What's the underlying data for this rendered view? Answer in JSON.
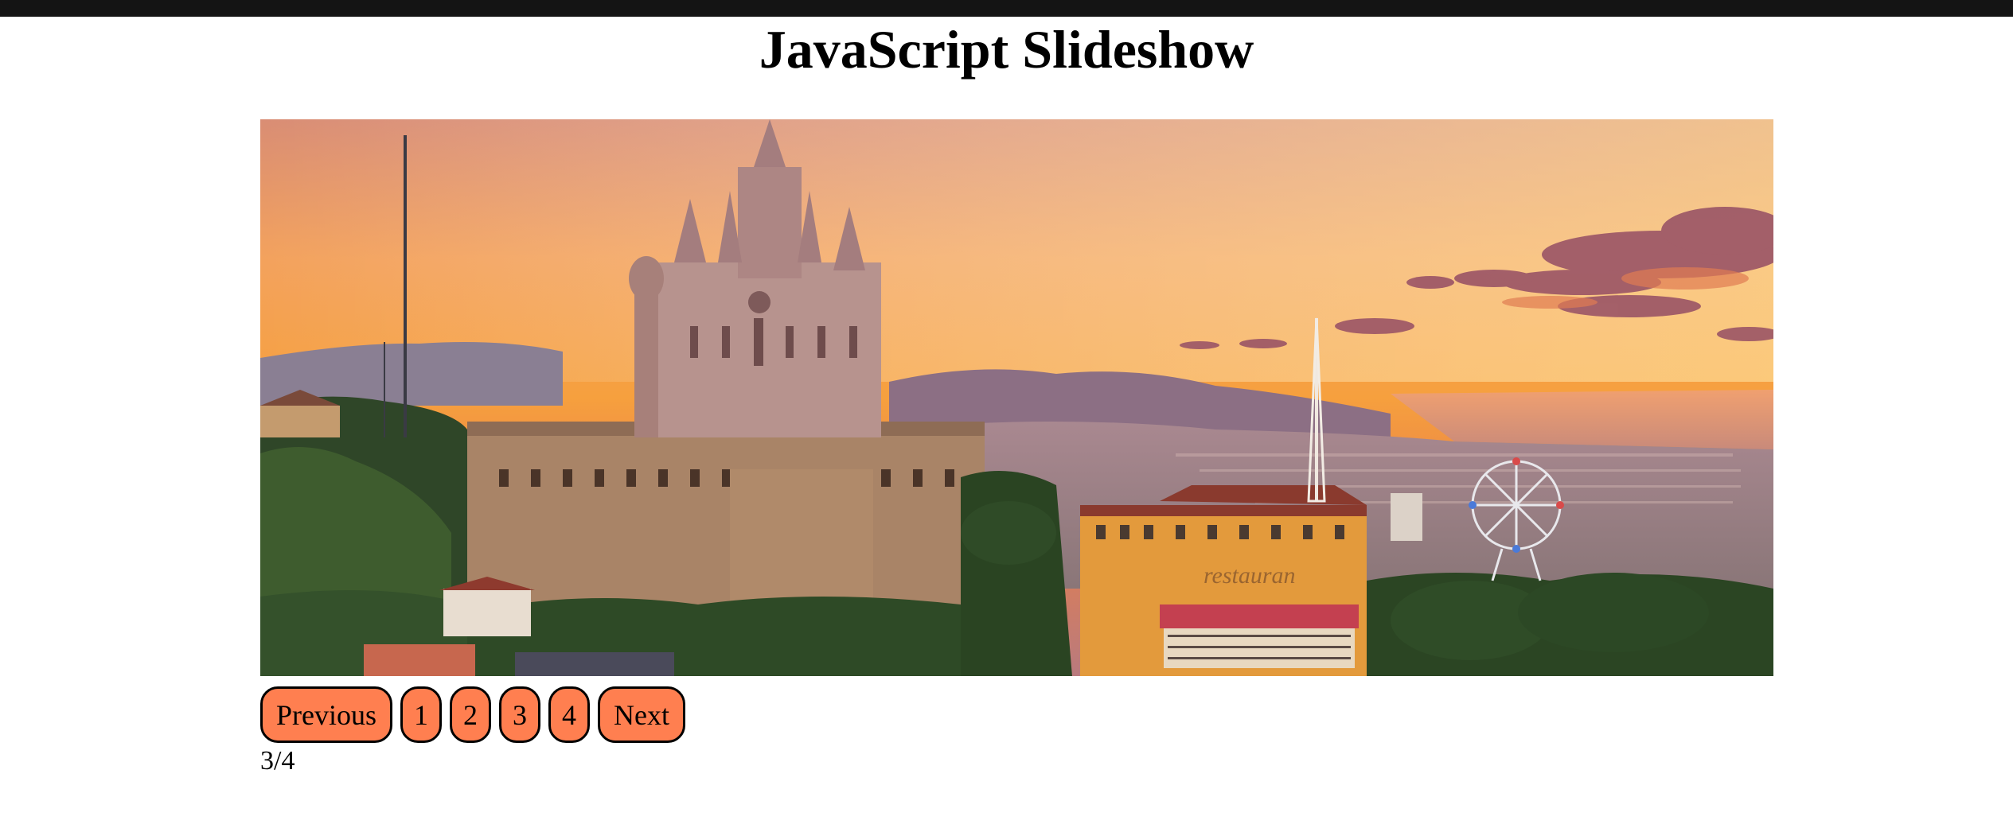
{
  "page": {
    "title": "JavaScript Slideshow",
    "counter": "3/4"
  },
  "slideshow": {
    "previous_label": "Previous",
    "next_label": "Next",
    "dots": [
      "1",
      "2",
      "3",
      "4"
    ],
    "current_index": 3,
    "total": 4,
    "button_color": "#ff7f50"
  },
  "slide": {
    "sign_text": "restauran"
  }
}
